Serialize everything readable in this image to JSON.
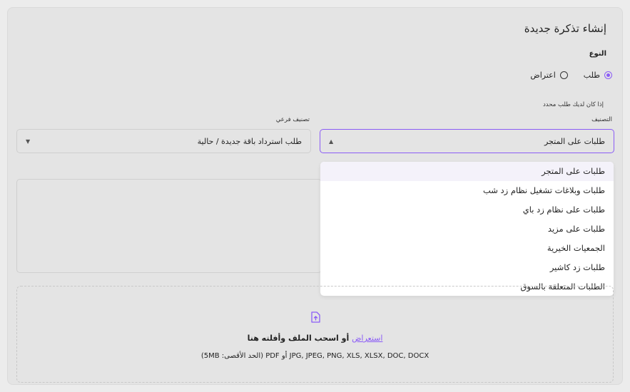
{
  "form": {
    "title": "إنشاء تذكرة جديدة",
    "type_label": "النوع",
    "type_options": [
      {
        "label": "طلب",
        "checked": true
      },
      {
        "label": "اعتراض",
        "checked": false
      }
    ],
    "hint": "إذا كان لديك طلب محدد",
    "category_label": "التصنيف",
    "category_value": "طلبات على المتجر",
    "subcategory_label": "تصنيف فرعي",
    "subcategory_value": "طلب استرداد باقة جديدة / حالية"
  },
  "dropdown": {
    "options": [
      "طلبات على المتجر",
      "طلبات وبلاغات تشغيل نظام زد شب",
      "طلبات على نظام زد باي",
      "طلبات على مزيد",
      "الجمعيات الخيرية",
      "طلبات زد كاشير",
      "الطلبات المتعلقة بالسوق"
    ]
  },
  "upload": {
    "browse_label": "استعراض",
    "drag_text": "أو اسحب الملف وأفلته هنا",
    "formats_text": "JPG, JPEG, PNG, XLS, XLSX, DOC, DOCX أو PDF (الحد الأقصى: 5MB)"
  },
  "colors": {
    "accent": "#8b5cf6"
  }
}
